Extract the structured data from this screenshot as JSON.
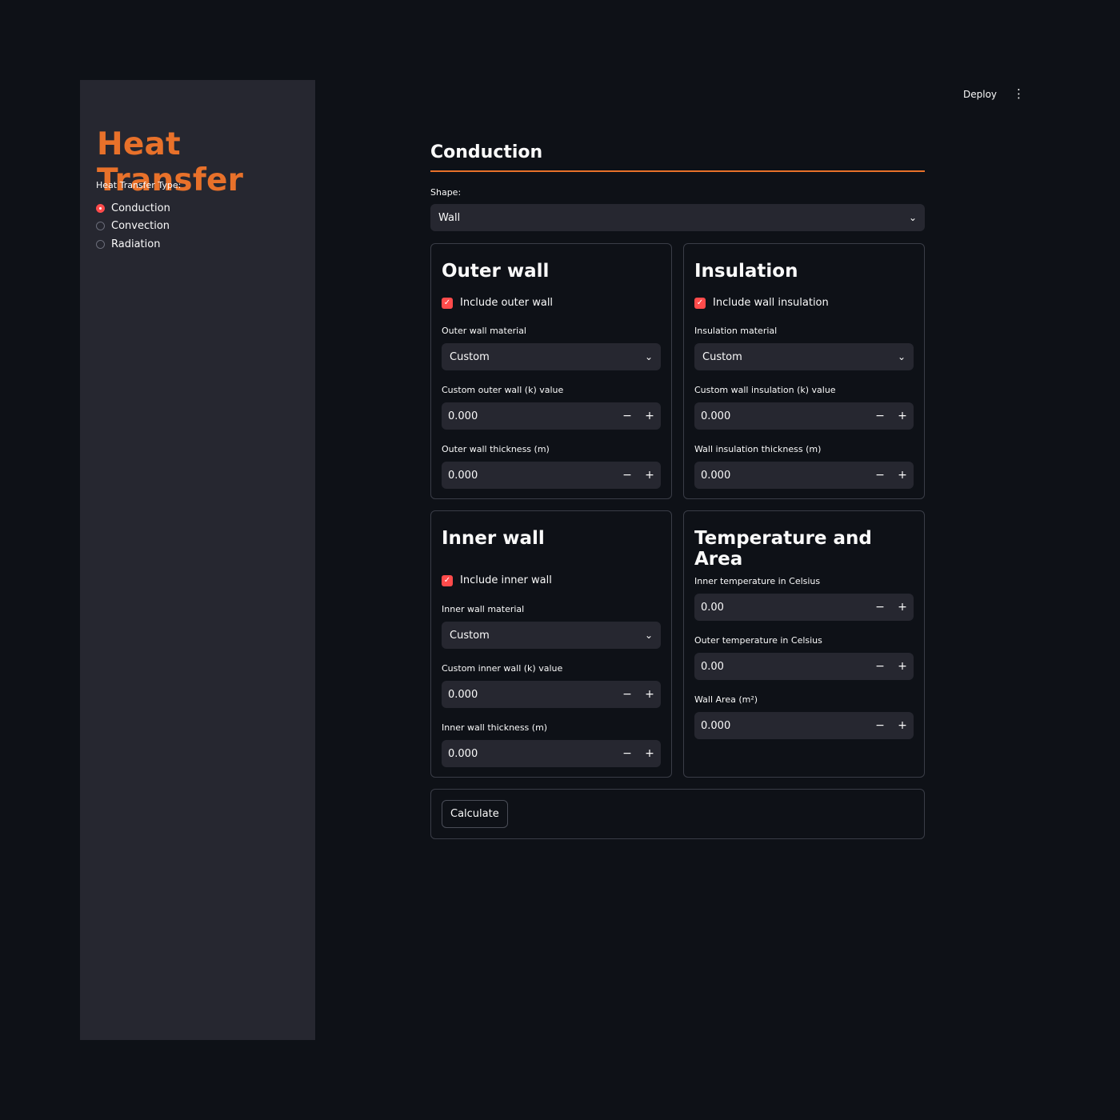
{
  "sidebar": {
    "title": "Heat Transfer",
    "radio_label": "Heat Transfer Type:",
    "options": [
      "Conduction",
      "Convection",
      "Radiation"
    ],
    "selected": "Conduction"
  },
  "topbar": {
    "deploy_label": "Deploy"
  },
  "main": {
    "section_title": "Conduction",
    "shape": {
      "label": "Shape:",
      "value": "Wall"
    },
    "outer_wall": {
      "title": "Outer wall",
      "include_label": "Include outer wall",
      "material_label": "Outer wall material",
      "material_value": "Custom",
      "k_label": "Custom outer wall (k) value",
      "k_value": "0.000",
      "thickness_label": "Outer wall thickness (m)",
      "thickness_value": "0.000"
    },
    "insulation": {
      "title": "Insulation",
      "include_label": "Include wall insulation",
      "material_label": "Insulation material",
      "material_value": "Custom",
      "k_label": "Custom wall insulation (k) value",
      "k_value": "0.000",
      "thickness_label": "Wall insulation thickness (m)",
      "thickness_value": "0.000"
    },
    "inner_wall": {
      "title": "Inner wall",
      "include_label": "Include inner wall",
      "material_label": "Inner wall material",
      "material_value": "Custom",
      "k_label": "Custom inner wall (k) value",
      "k_value": "0.000",
      "thickness_label": "Inner wall thickness (m)",
      "thickness_value": "0.000"
    },
    "temp_area": {
      "title": "Temperature and Area",
      "inner_temp_label": "Inner temperature in Celsius",
      "inner_temp_value": "0.00",
      "outer_temp_label": "Outer temperature in Celsius",
      "outer_temp_value": "0.00",
      "area_label": "Wall Area (m²)",
      "area_value": "0.000"
    },
    "calculate_label": "Calculate"
  },
  "icons": {
    "minus": "−",
    "plus": "+",
    "chevron": "⌄",
    "check": "✓",
    "menu": "⋮"
  },
  "colors": {
    "accent": "#e8712a",
    "primary": "#ff4b4b",
    "background": "#0e1117",
    "sidebar": "#262730"
  }
}
